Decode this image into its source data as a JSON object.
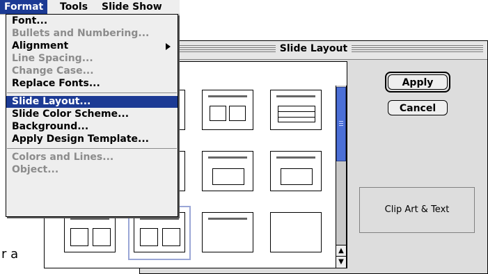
{
  "background_fragment": "r a",
  "menubar": {
    "items": [
      {
        "label": "Format",
        "active": true
      },
      {
        "label": "Tools",
        "active": false
      },
      {
        "label": "Slide Show",
        "active": false
      }
    ]
  },
  "format_menu": {
    "items": [
      {
        "label": "Font...",
        "enabled": true
      },
      {
        "label": "Bullets and Numbering...",
        "enabled": false
      },
      {
        "label": "Alignment",
        "enabled": true,
        "submenu": true
      },
      {
        "label": "Line Spacing...",
        "enabled": false
      },
      {
        "label": "Change Case...",
        "enabled": false
      },
      {
        "label": "Replace Fonts...",
        "enabled": true
      },
      {
        "label": "Slide Layout...",
        "enabled": true,
        "highlighted": true
      },
      {
        "label": "Slide Color Scheme...",
        "enabled": true
      },
      {
        "label": "Background...",
        "enabled": true
      },
      {
        "label": "Apply Design Template...",
        "enabled": true
      },
      {
        "label": "Colors and Lines...",
        "enabled": false
      },
      {
        "label": "Object...",
        "enabled": false
      }
    ]
  },
  "dialog": {
    "title": "Slide Layout",
    "apply_label": "Apply",
    "cancel_label": "Cancel",
    "selected_layout_name": "Clip Art & Text"
  },
  "colors": {
    "highlight": "#1c3a94",
    "selection_ring": "#9aa6d6",
    "scroll_thumb": "#4b6fd6"
  }
}
